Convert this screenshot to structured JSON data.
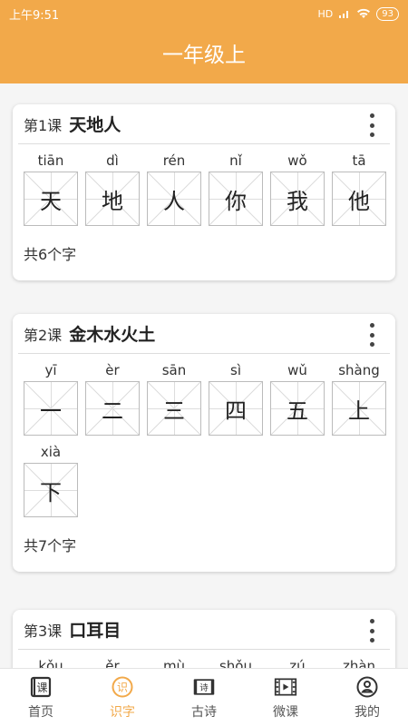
{
  "status": {
    "time": "上午9:51",
    "network": "HD",
    "battery": "93"
  },
  "header": {
    "title": "一年级上"
  },
  "lessons": [
    {
      "no": "第1课",
      "name": "天地人",
      "chars": [
        {
          "py": "tiān",
          "ch": "天"
        },
        {
          "py": "dì",
          "ch": "地"
        },
        {
          "py": "rén",
          "ch": "人"
        },
        {
          "py": "nǐ",
          "ch": "你"
        },
        {
          "py": "wǒ",
          "ch": "我"
        },
        {
          "py": "tā",
          "ch": "他"
        }
      ],
      "count": "共6个字"
    },
    {
      "no": "第2课",
      "name": "金木水火土",
      "chars": [
        {
          "py": "yī",
          "ch": "一"
        },
        {
          "py": "èr",
          "ch": "二"
        },
        {
          "py": "sān",
          "ch": "三"
        },
        {
          "py": "sì",
          "ch": "四"
        },
        {
          "py": "wǔ",
          "ch": "五"
        },
        {
          "py": "shàng",
          "ch": "上"
        },
        {
          "py": "xià",
          "ch": "下"
        }
      ],
      "count": "共7个字"
    },
    {
      "no": "第3课",
      "name": "口耳目",
      "chars": [
        {
          "py": "kǒu",
          "ch": ""
        },
        {
          "py": "ěr",
          "ch": ""
        },
        {
          "py": "mù",
          "ch": ""
        },
        {
          "py": "shǒu",
          "ch": ""
        },
        {
          "py": "zú",
          "ch": ""
        },
        {
          "py": "zhàn",
          "ch": ""
        }
      ],
      "count": ""
    }
  ],
  "tabs": {
    "home": "首页",
    "literacy": "识字",
    "poems": "古诗",
    "video": "微课",
    "mine": "我的",
    "active_color": "#f2a94a",
    "inactive_color": "#555555"
  },
  "colors": {
    "accent": "#f2a94a"
  }
}
